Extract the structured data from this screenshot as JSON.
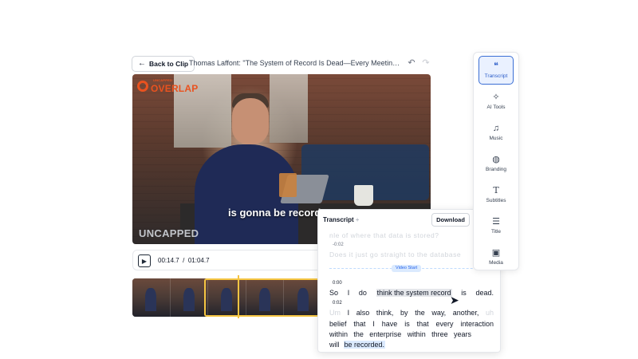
{
  "header": {
    "back_label": "Back to Clip",
    "clip_title": "Thomas Laffont: \"The System of Record Is Dead—Every Meeting Will ..."
  },
  "video": {
    "brand_small": "UNCAPPED",
    "brand_logo": "OVERLAP",
    "brand_corner": "UNCAPPED",
    "caption": "is gonna be record"
  },
  "player": {
    "current_time": "00:14.7",
    "separator": "/",
    "total_time": "01:04.7"
  },
  "transcript": {
    "title": "Transcript",
    "plus": "+",
    "download_label": "Download",
    "faded_line_1": "nle   of   where   that   data   is   stored?",
    "ts_neg": "-0:02",
    "faded_line_2": "Does   it   just   go   straight   to   the   database",
    "video_start": "Video Start",
    "ts_0": "0:00",
    "line1": [
      "So",
      "I",
      "do",
      "think  the  system  record",
      "is",
      "dead."
    ],
    "ts_2": "0:02",
    "line2": [
      "Um",
      "I",
      "also",
      "think,",
      "by",
      "the",
      "way,",
      "another,",
      "uh"
    ],
    "line3": [
      "belief",
      "that",
      "I",
      "have",
      "is",
      "that",
      "every",
      "interaction"
    ],
    "line4": [
      "within",
      "the",
      "enterprise",
      "within",
      "three",
      "years"
    ],
    "line5": [
      "will",
      "be  recorded."
    ]
  },
  "tools": [
    {
      "label": "Transcript",
      "icon": "quote-icon",
      "active": true
    },
    {
      "label": "AI Tools",
      "icon": "magic-wand-icon",
      "active": false
    },
    {
      "label": "Music",
      "icon": "music-note-icon",
      "active": false
    },
    {
      "label": "Branding",
      "icon": "palette-icon",
      "active": false
    },
    {
      "label": "Subtitles",
      "icon": "text-t-icon",
      "active": false
    },
    {
      "label": "Title",
      "icon": "align-lines-icon",
      "active": false
    },
    {
      "label": "Media",
      "icon": "image-icon",
      "active": false
    }
  ],
  "colors": {
    "accent": "#3b6fd4",
    "brand_orange": "#e9521f",
    "selection_yellow": "#f5c542"
  }
}
